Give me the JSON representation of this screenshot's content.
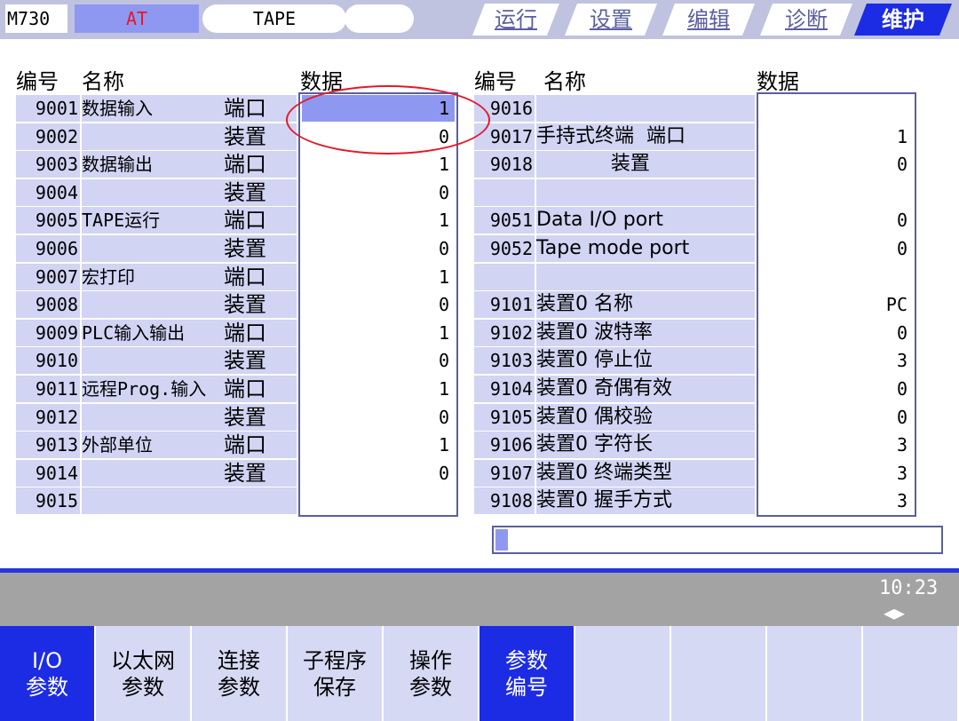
{
  "topbar": {
    "model": "M730",
    "mode": "AT",
    "tape": "TAPE",
    "tabs": [
      "运行",
      "设置",
      "编辑",
      "诊断",
      "维护"
    ]
  },
  "headers": {
    "left": {
      "no": "编号",
      "name": "名称",
      "data": "数据"
    },
    "right": {
      "no": "编号",
      "name": "名称",
      "data": "数据"
    }
  },
  "left_rows": [
    {
      "no": "9001",
      "name": "数据输入",
      "unit": "端口",
      "value": "1"
    },
    {
      "no": "9002",
      "name": "",
      "unit": "装置",
      "value": "0"
    },
    {
      "no": "9003",
      "name": "数据输出",
      "unit": "端口",
      "value": "1"
    },
    {
      "no": "9004",
      "name": "",
      "unit": "装置",
      "value": "0"
    },
    {
      "no": "9005",
      "name": "TAPE运行",
      "unit": "端口",
      "value": "1"
    },
    {
      "no": "9006",
      "name": "",
      "unit": "装置",
      "value": "0"
    },
    {
      "no": "9007",
      "name": "宏打印",
      "unit": "端口",
      "value": "1"
    },
    {
      "no": "9008",
      "name": "",
      "unit": "装置",
      "value": "0"
    },
    {
      "no": "9009",
      "name": "PLC输入输出",
      "unit": "端口",
      "value": "1"
    },
    {
      "no": "9010",
      "name": "",
      "unit": "装置",
      "value": "0"
    },
    {
      "no": "9011",
      "name": "远程Prog.输入",
      "unit": "端口",
      "value": "1"
    },
    {
      "no": "9012",
      "name": "",
      "unit": "装置",
      "value": "0"
    },
    {
      "no": "9013",
      "name": "外部单位",
      "unit": "端口",
      "value": "1"
    },
    {
      "no": "9014",
      "name": "",
      "unit": "装置",
      "value": "0"
    },
    {
      "no": "9015",
      "name": "",
      "unit": "",
      "value": ""
    }
  ],
  "right_rows": [
    {
      "no": "9016",
      "name": "",
      "value": ""
    },
    {
      "no": "9017",
      "name": "手持式终端  端口",
      "value": "1"
    },
    {
      "no": "9018",
      "name": "            装置",
      "value": "0"
    },
    {
      "no": "",
      "name": "",
      "value": ""
    },
    {
      "no": "9051",
      "name": "Data I/O port",
      "value": "0"
    },
    {
      "no": "9052",
      "name": "Tape mode port",
      "value": "0"
    },
    {
      "no": "",
      "name": "",
      "value": ""
    },
    {
      "no": "9101",
      "name": "装置0 名称",
      "value": "PC"
    },
    {
      "no": "9102",
      "name": "装置0 波特率",
      "value": "0"
    },
    {
      "no": "9103",
      "name": "装置0 停止位",
      "value": "3"
    },
    {
      "no": "9104",
      "name": "装置0 奇偶有效",
      "value": "0"
    },
    {
      "no": "9105",
      "name": "装置0 偶校验",
      "value": "0"
    },
    {
      "no": "9106",
      "name": "装置0 字符长",
      "value": "3"
    },
    {
      "no": "9107",
      "name": "装置0 终端类型",
      "value": "3"
    },
    {
      "no": "9108",
      "name": "装置0 握手方式",
      "value": "3"
    }
  ],
  "status": {
    "time": "10:23",
    "arrows": "◀▶"
  },
  "softkeys": [
    {
      "line1": "I/O",
      "line2": "参数",
      "active": true
    },
    {
      "line1": "以太网",
      "line2": "参数",
      "active": false
    },
    {
      "line1": "连接",
      "line2": "参数",
      "active": false
    },
    {
      "line1": "子程序",
      "line2": "保存",
      "active": false
    },
    {
      "line1": "操作",
      "line2": "参数",
      "active": false
    },
    {
      "line1": "参数",
      "line2": "编号",
      "active": true
    },
    {
      "line1": "",
      "line2": "",
      "active": false
    },
    {
      "line1": "",
      "line2": "",
      "active": false
    },
    {
      "line1": "",
      "line2": "",
      "active": false
    },
    {
      "line1": "",
      "line2": "",
      "active": false
    }
  ],
  "colors": {
    "accent": "#1c2ce4",
    "highlight": "#8f98f0",
    "cell": "#d1d4f3",
    "annotation": "#e4192a"
  }
}
